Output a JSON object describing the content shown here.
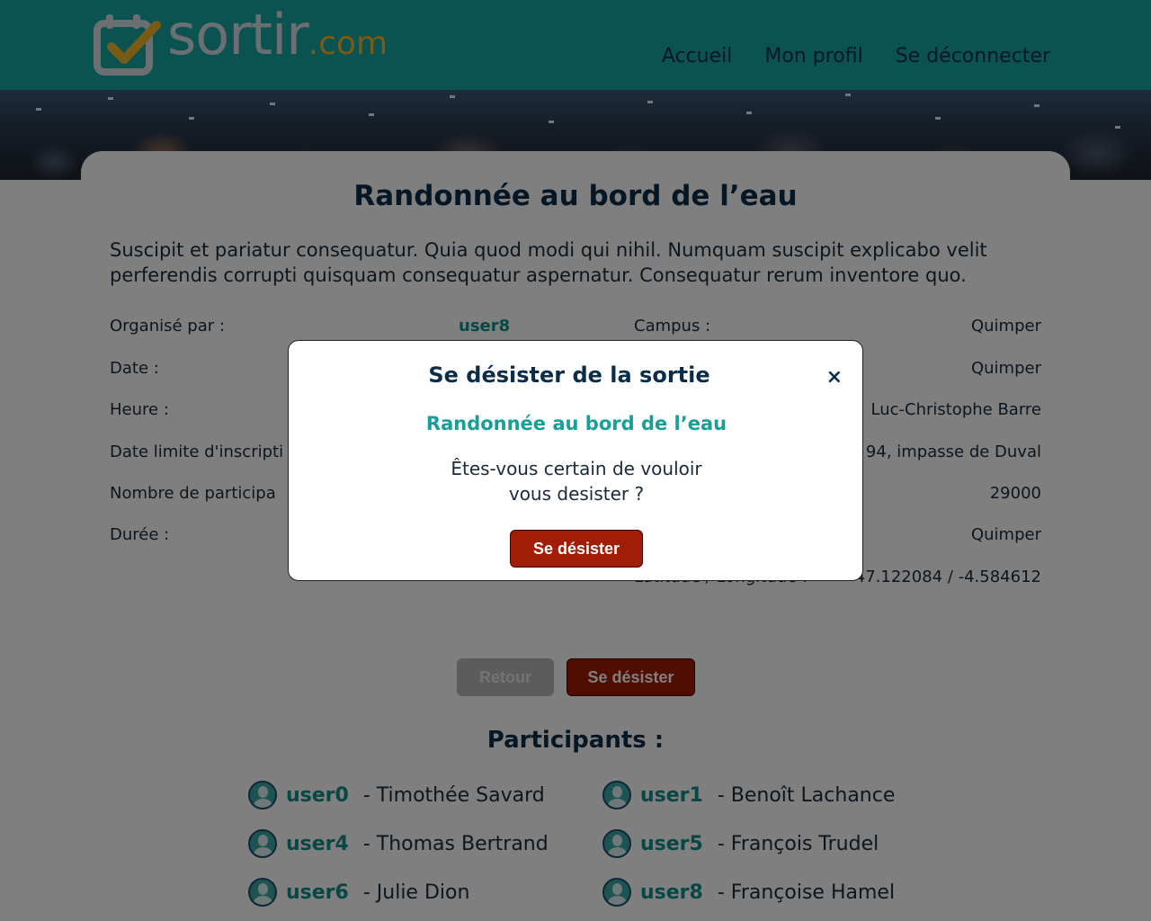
{
  "header": {
    "logo_main": "sortir",
    "logo_suffix": ".com",
    "nav": [
      "Accueil",
      "Mon profil",
      "Se déconnecter"
    ]
  },
  "event": {
    "title": "Randonnée au bord de l’eau",
    "description": "Suscipit et pariatur consequatur. Quia quod modi qui nihil. Numquam suscipit explicabo velit perferendis corrupti quisquam consequatur aspernatur. Consequatur rerum inventore quo.",
    "left_labels": [
      "Organisé par :",
      "Date :",
      "Heure :",
      "Date limite d'inscripti",
      "Nombre de participa",
      "Durée :"
    ],
    "organizer": "user8",
    "right_label_visible": "Campus :",
    "right_label_partial": "Latitude / Longitude :",
    "right_values": [
      "Quimper",
      "Quimper",
      "Luc-Christophe Barre",
      "94, impasse de Duval",
      "29000",
      "Quimper",
      "47.122084 / -4.584612"
    ]
  },
  "buttons": {
    "back": "Retour",
    "leave": "Se désister"
  },
  "participants": {
    "title": "Participants :",
    "list": [
      {
        "user": "user0",
        "name": "- Timothée Savard"
      },
      {
        "user": "user1",
        "name": "- Benoît Lachance"
      },
      {
        "user": "user4",
        "name": "- Thomas Bertrand"
      },
      {
        "user": "user5",
        "name": "- François Trudel"
      },
      {
        "user": "user6",
        "name": "- Julie Dion"
      },
      {
        "user": "user8",
        "name": "- Françoise Hamel"
      }
    ]
  },
  "modal": {
    "title": "Se désister de la sortie",
    "close": "×",
    "event_name": "Randonnée au bord de l’eau",
    "message": "Êtes-vous certain de vouloir vous desister ?",
    "confirm": "Se désister"
  },
  "colors": {
    "header_bg": "#16a7a1",
    "primary_dark": "#0b2d4a",
    "accent_teal": "#0f8f8a",
    "danger": "#a11d05"
  }
}
